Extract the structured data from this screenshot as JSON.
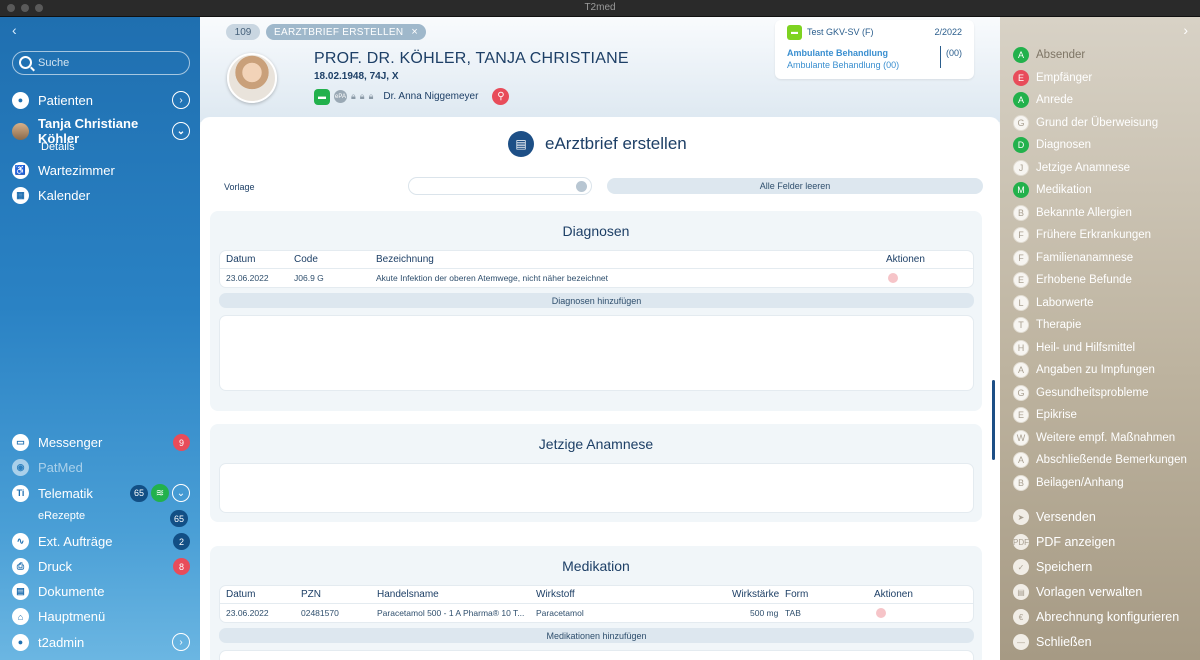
{
  "window": {
    "title": "T2med"
  },
  "sidebar": {
    "back": "‹",
    "search_placeholder": "Suche",
    "patienten": "Patienten",
    "patient_name": "Tanja Christiane Köhler",
    "details": "Details",
    "wartezimmer": "Wartezimmer",
    "kalender": "Kalender",
    "messenger": "Messenger",
    "messenger_badge": "9",
    "patmed": "PatMed",
    "telematik": "Telematik",
    "telematik_badge": "65",
    "erezepte": "eRezepte",
    "erezepte_badge": "65",
    "ext_auftraege": "Ext. Aufträge",
    "ext_badge": "2",
    "druck": "Druck",
    "druck_badge": "8",
    "dokumente": "Dokumente",
    "hauptmenu": "Hauptmenü",
    "user": "t2admin"
  },
  "header": {
    "count": "109",
    "tab": "EARZTBRIEF ERSTELLEN",
    "tab_close": "×",
    "patient_name": "PROF. DR. KÖHLER,  TANJA CHRISTIANE",
    "dob": "18.02.1948, 74J, X",
    "doctor": "Dr.  Anna Niggemeyer",
    "insurance": "Test GKV-SV (F)",
    "quarter": "2/2022",
    "treatment_title": "Ambulante Behandlung",
    "treatment_sub": "Ambulante Behandlung (00)",
    "treatment_code": "(00)"
  },
  "content": {
    "title": "eArztbrief erstellen",
    "vorlage_label": "Vorlage",
    "clear_label": "Alle Felder leeren",
    "diagnosen": {
      "title": "Diagnosen",
      "headers": [
        "Datum",
        "Code",
        "Bezeichnung",
        "Aktionen"
      ],
      "rows": [
        {
          "datum": "23.06.2022",
          "code": "J06.9 G",
          "bezeichnung": "Akute Infektion der oberen Atemwege, nicht näher bezeichnet"
        }
      ],
      "add_label": "Diagnosen hinzufügen"
    },
    "anamnese": {
      "title": "Jetzige Anamnese"
    },
    "medikation": {
      "title": "Medikation",
      "headers": [
        "Datum",
        "PZN",
        "Handelsname",
        "Wirkstoff",
        "Wirkstärke",
        "Form",
        "Aktionen"
      ],
      "rows": [
        {
          "datum": "23.06.2022",
          "pzn": "02481570",
          "handelsname": "Paracetamol 500 - 1 A Pharma® 10 T...",
          "wirkstoff": "Paracetamol",
          "wirkstaerke": "500 mg",
          "form": "TAB"
        }
      ],
      "add_label": "Medikationen hinzufügen"
    }
  },
  "right_panel": {
    "chevron": "›",
    "sections": [
      {
        "letter": "A",
        "label": "Absender",
        "state": "green-dim"
      },
      {
        "letter": "E",
        "label": "Empfänger",
        "state": "red"
      },
      {
        "letter": "A",
        "label": "Anrede",
        "state": "green"
      },
      {
        "letter": "G",
        "label": "Grund der Überweisung",
        "state": "white"
      },
      {
        "letter": "D",
        "label": "Diagnosen",
        "state": "green"
      },
      {
        "letter": "J",
        "label": "Jetzige Anamnese",
        "state": "white"
      },
      {
        "letter": "M",
        "label": "Medikation",
        "state": "green"
      },
      {
        "letter": "B",
        "label": "Bekannte Allergien",
        "state": "white"
      },
      {
        "letter": "F",
        "label": "Frühere Erkrankungen",
        "state": "white"
      },
      {
        "letter": "F",
        "label": "Familienanamnese",
        "state": "white"
      },
      {
        "letter": "E",
        "label": "Erhobene Befunde",
        "state": "white"
      },
      {
        "letter": "L",
        "label": "Laborwerte",
        "state": "white"
      },
      {
        "letter": "T",
        "label": "Therapie",
        "state": "white"
      },
      {
        "letter": "H",
        "label": "Heil- und Hilfsmittel",
        "state": "white"
      },
      {
        "letter": "A",
        "label": "Angaben zu Impfungen",
        "state": "white"
      },
      {
        "letter": "G",
        "label": "Gesundheitsprobleme",
        "state": "white"
      },
      {
        "letter": "E",
        "label": "Epikrise",
        "state": "white"
      },
      {
        "letter": "W",
        "label": "Weitere empf. Maßnahmen",
        "state": "white"
      },
      {
        "letter": "A",
        "label": "Abschließende Bemerkungen",
        "state": "white"
      },
      {
        "letter": "B",
        "label": "Beilagen/Anhang",
        "state": "white"
      }
    ],
    "actions": [
      {
        "icon": "send-icon",
        "label": "Versenden"
      },
      {
        "icon": "pdf-icon",
        "label": "PDF anzeigen"
      },
      {
        "icon": "check-icon",
        "label": "Speichern"
      },
      {
        "icon": "template-icon",
        "label": "Vorlagen verwalten"
      },
      {
        "icon": "euro-icon",
        "label": "Abrechnung konfigurieren"
      },
      {
        "icon": "close-circle-icon",
        "label": "Schließen"
      }
    ]
  }
}
